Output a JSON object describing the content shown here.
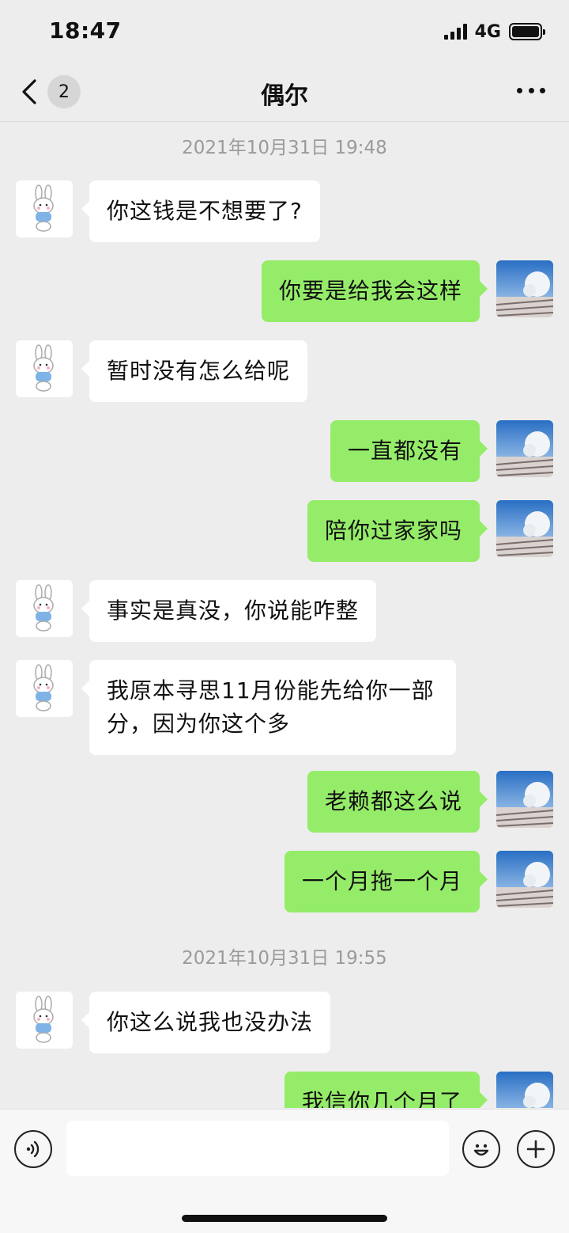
{
  "status_bar": {
    "time": "18:47",
    "network": "4G",
    "icons": [
      "signal-icon",
      "battery-icon"
    ]
  },
  "nav": {
    "back_icon": "chevron-left-icon",
    "unread_count": "2",
    "title": "偶尔",
    "more_icon": "more-dots-icon"
  },
  "messages": {
    "timestamp_1": "2021年10月31日 19:48",
    "timestamp_2": "2021年10月31日 19:55",
    "items": [
      {
        "side": "left",
        "text": "你这钱是不想要了?"
      },
      {
        "side": "right",
        "text": "你要是给我会这样"
      },
      {
        "side": "left",
        "text": "暂时没有怎么给呢"
      },
      {
        "side": "right",
        "text": "一直都没有"
      },
      {
        "side": "right",
        "text": "陪你过家家吗"
      },
      {
        "side": "left",
        "text": "事实是真没，你说能咋整"
      },
      {
        "side": "left",
        "text": "我原本寻思11月份能先给你一部分，因为你这个多"
      },
      {
        "side": "right",
        "text": "老赖都这么说"
      },
      {
        "side": "right",
        "text": "一个月拖一个月"
      },
      {
        "side": "left",
        "text": "你这么说我也没办法"
      },
      {
        "side": "right",
        "text": "我信你几个月了"
      }
    ]
  },
  "input_bar": {
    "voice_icon": "voice-icon",
    "input_value": "",
    "emoji_icon": "emoji-icon",
    "plus_icon": "plus-icon"
  },
  "colors": {
    "background": "#ededed",
    "sent_bubble": "#95ec69",
    "received_bubble": "#ffffff",
    "timestamp_text": "#9a9a9a"
  }
}
